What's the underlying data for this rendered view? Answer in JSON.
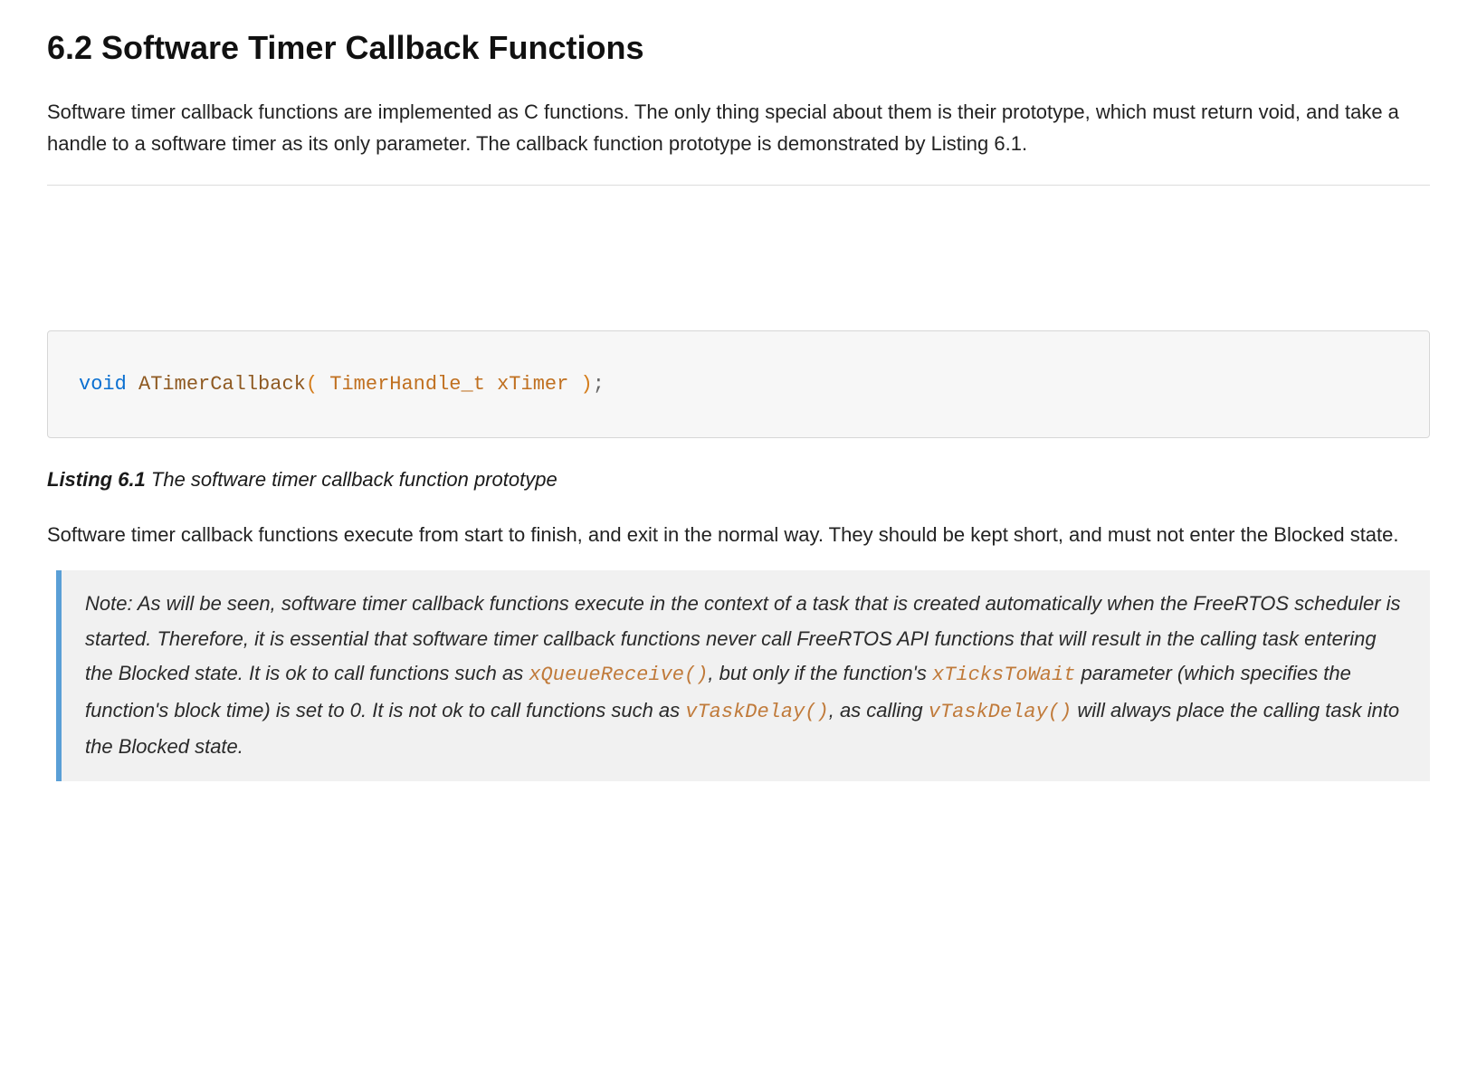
{
  "heading": "6.2 Software Timer Callback Functions",
  "intro_paragraph": "Software timer callback functions are implemented as C functions. The only thing special about them is their prototype, which must return void, and take a handle to a software timer as its only parameter. The callback function prototype is demonstrated by Listing 6.1.",
  "code_block": {
    "keyword": "void",
    "function_name": "ATimerCallback",
    "open_paren": "(",
    "param_type": "TimerHandle_t",
    "param_name": "xTimer",
    "close_paren": ")",
    "terminator": ";"
  },
  "listing_caption": {
    "lead": "Listing 6.1",
    "desc": " The software timer callback function prototype"
  },
  "mid_paragraph": "Software timer callback functions execute from start to finish, and exit in the normal way. They should be kept short, and must not enter the Blocked state.",
  "note": {
    "part1": "Note: As will be seen, software timer callback functions execute in the context of a task that is created automatically when the FreeRTOS scheduler is started. Therefore, it is essential that software timer callback functions never call FreeRTOS API functions that will result in the calling task entering the Blocked state. It is ok to call functions such as ",
    "code1": "xQueueReceive()",
    "part2": ", but only if the function's ",
    "code2": "xTicksToWait",
    "part3": " parameter (which specifies the function's block time) is set to 0. It is not ok to call functions such as ",
    "code3": "vTaskDelay()",
    "part4": ", as calling ",
    "code4": "vTaskDelay()",
    "part5": " will always place the calling task into the Blocked state."
  }
}
